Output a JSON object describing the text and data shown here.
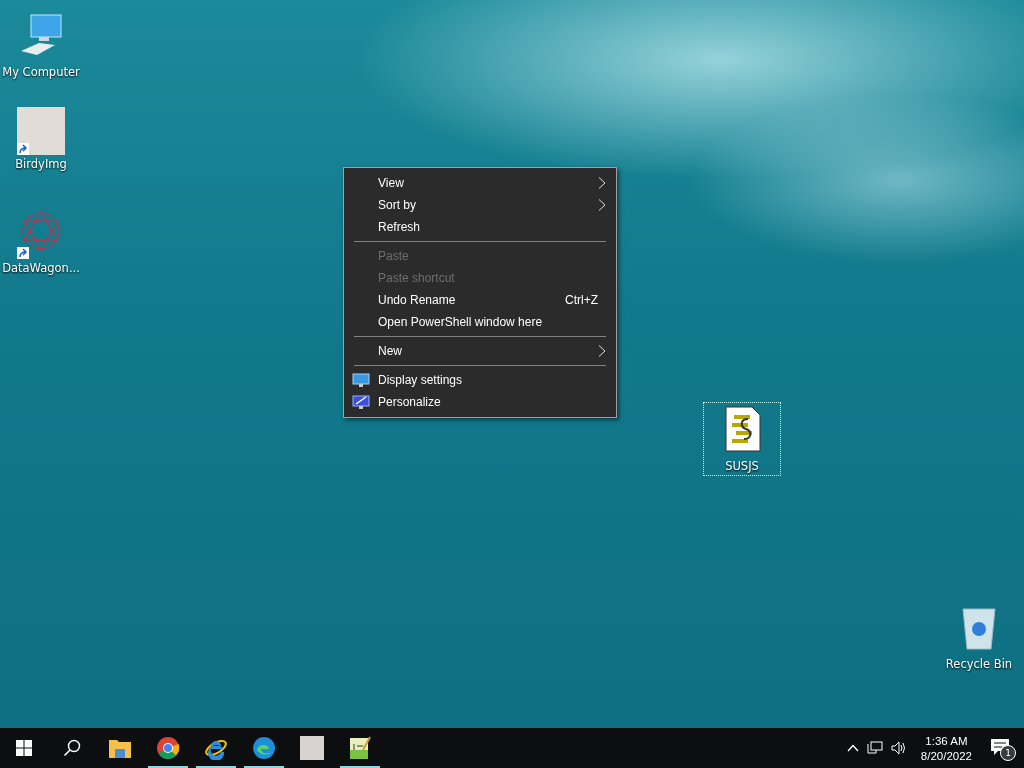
{
  "desktop_icons": [
    {
      "label": "My Computer",
      "kind": "computer",
      "shortcut": false,
      "selected": false
    },
    {
      "label": "BirdyImg",
      "kind": "photo",
      "shortcut": true,
      "selected": false
    },
    {
      "label": "DataWagon...",
      "kind": "pattern",
      "shortcut": true,
      "selected": false
    },
    {
      "label": "SUSJS",
      "kind": "script",
      "shortcut": false,
      "selected": true
    },
    {
      "label": "Recycle Bin",
      "kind": "bin",
      "shortcut": false,
      "selected": false
    }
  ],
  "context_menu": [
    {
      "kind": "item",
      "label": "View",
      "submenu": true,
      "disabled": false
    },
    {
      "kind": "item",
      "label": "Sort by",
      "submenu": true,
      "disabled": false
    },
    {
      "kind": "item",
      "label": "Refresh",
      "submenu": false,
      "disabled": false
    },
    {
      "kind": "separator"
    },
    {
      "kind": "item",
      "label": "Paste",
      "submenu": false,
      "disabled": true
    },
    {
      "kind": "item",
      "label": "Paste shortcut",
      "submenu": false,
      "disabled": true
    },
    {
      "kind": "item",
      "label": "Undo Rename",
      "shortcut": "Ctrl+Z",
      "submenu": false,
      "disabled": false
    },
    {
      "kind": "item",
      "label": "Open PowerShell window here",
      "submenu": false,
      "disabled": false
    },
    {
      "kind": "separator"
    },
    {
      "kind": "item",
      "label": "New",
      "submenu": true,
      "disabled": false
    },
    {
      "kind": "separator"
    },
    {
      "kind": "display",
      "label": "Display settings",
      "submenu": false,
      "disabled": false
    },
    {
      "kind": "personalize",
      "label": "Personalize",
      "submenu": false,
      "disabled": false
    }
  ],
  "taskbar": {
    "apps": [
      {
        "kind": "folder",
        "running": false
      },
      {
        "kind": "chrome",
        "running": true
      },
      {
        "kind": "ie",
        "running": true
      },
      {
        "kind": "edge",
        "running": true
      },
      {
        "kind": "photo",
        "running": false
      },
      {
        "kind": "notepad",
        "running": true
      }
    ],
    "clock_time": "1:36 AM",
    "clock_date": "8/20/2022",
    "notification_count": "1"
  }
}
